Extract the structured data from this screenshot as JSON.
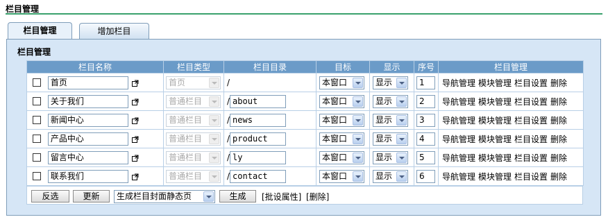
{
  "page": {
    "title": "栏目管理"
  },
  "tabs": [
    {
      "label": "栏目管理"
    },
    {
      "label": "增加栏目"
    }
  ],
  "panel": {
    "title": "栏目管理"
  },
  "table": {
    "headers": [
      "栏目名称",
      "栏目类型",
      "栏目目录",
      "目标",
      "显示",
      "序号",
      "栏目管理"
    ],
    "rows": [
      {
        "name": "首页",
        "type": "首页",
        "dir_prefix": "/",
        "dir": "",
        "target": "本窗口",
        "display": "显示",
        "order": "1"
      },
      {
        "name": "关于我们",
        "type": "普通栏目",
        "dir_prefix": "/",
        "dir": "about",
        "target": "本窗口",
        "display": "显示",
        "order": "2"
      },
      {
        "name": "新闻中心",
        "type": "普通栏目",
        "dir_prefix": "/",
        "dir": "news",
        "target": "本窗口",
        "display": "显示",
        "order": "3"
      },
      {
        "name": "产品中心",
        "type": "普通栏目",
        "dir_prefix": "/",
        "dir": "product",
        "target": "本窗口",
        "display": "显示",
        "order": "4"
      },
      {
        "name": "留言中心",
        "type": "普通栏目",
        "dir_prefix": "/",
        "dir": "ly",
        "target": "本窗口",
        "display": "显示",
        "order": "5"
      },
      {
        "name": "联系我们",
        "type": "普通栏目",
        "dir_prefix": "/",
        "dir": "contact",
        "target": "本窗口",
        "display": "显示",
        "order": "6"
      }
    ],
    "row_actions": [
      "导航管理",
      "模块管理",
      "栏目设置",
      "删除"
    ]
  },
  "footer": {
    "invert_button": "反选",
    "update_button": "更新",
    "generate_select": "生成栏目封面静态页",
    "generate_button": "生成",
    "batch_attr_link": "[批设属性]",
    "delete_link": "[删除]"
  }
}
